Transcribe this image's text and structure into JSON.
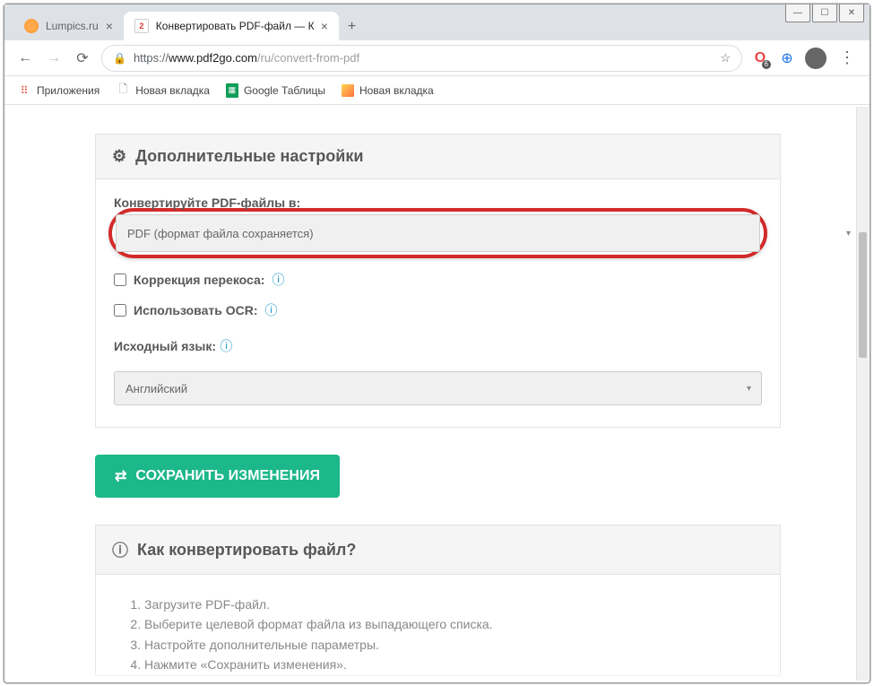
{
  "window": {
    "minimize": "—",
    "maximize": "☐",
    "close": "✕"
  },
  "tabs": {
    "tab1": {
      "title": "Lumpics.ru"
    },
    "tab2": {
      "title": "Конвертировать PDF-файл — К"
    }
  },
  "address": {
    "scheme": "https://",
    "host": "www.pdf2go.com",
    "path": "/ru/convert-from-pdf"
  },
  "bookmarks": {
    "apps": "Приложения",
    "newtab1": "Новая вкладка",
    "sheets": "Google Таблицы",
    "newtab2": "Новая вкладка"
  },
  "settings": {
    "panel_title": "Дополнительные настройки",
    "convert_label": "Конвертируйте PDF-файлы в:",
    "format_value": "PDF (формат файла сохраняется)",
    "deskew_label": "Коррекция перекоса:",
    "ocr_label": "Использовать OCR:",
    "source_lang_label": "Исходный язык:",
    "source_lang_value": "Английский"
  },
  "save_button": "СОХРАНИТЬ ИЗМЕНЕНИЯ",
  "help": {
    "title": "Как конвертировать файл?",
    "steps": {
      "s1": "Загрузите PDF-файл.",
      "s2": "Выберите целевой формат файла из выпадающего списка.",
      "s3": "Настройте дополнительные параметры.",
      "s4": "Нажмите «Сохранить изменения»."
    }
  },
  "ext_badge": "6"
}
